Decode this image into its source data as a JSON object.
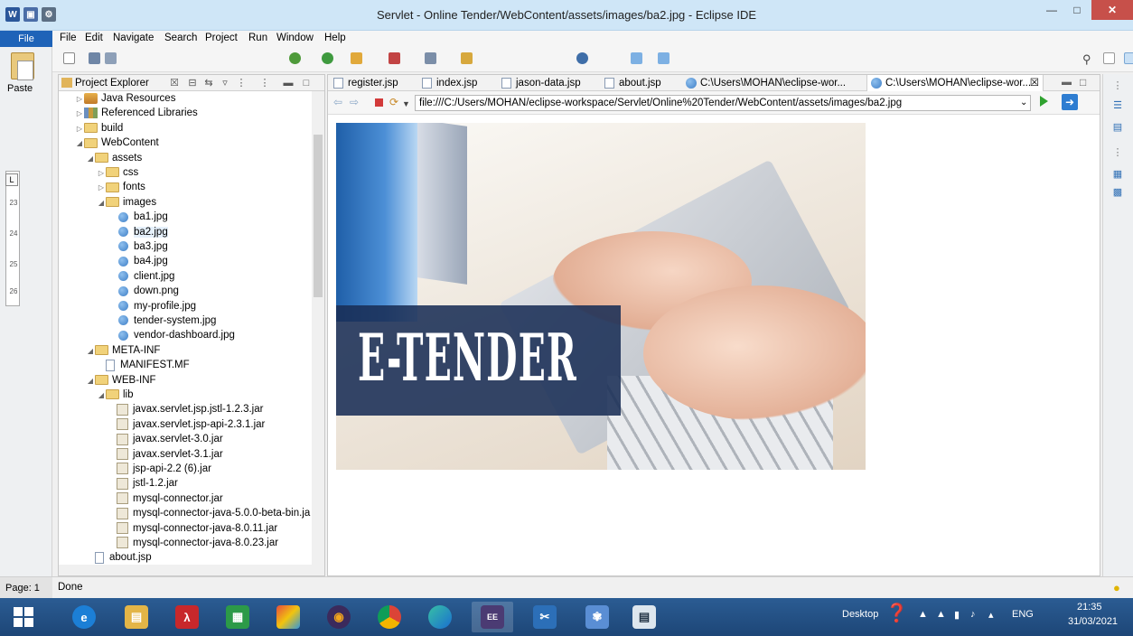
{
  "window": {
    "title": "Servlet - Online Tender/WebContent/assets/images/ba2.jpg - Eclipse IDE"
  },
  "menu": {
    "file": "File",
    "items": [
      "File",
      "Edit",
      "Navigate",
      "Search",
      "Project",
      "Run",
      "Window",
      "Help"
    ]
  },
  "ribbon": {
    "paste_label": "Paste"
  },
  "project_explorer": {
    "title": "Project Explorer",
    "close_glyph": "☒",
    "tree": [
      {
        "label": "Java Resources",
        "icon": "java-res",
        "twisty": "▷",
        "indent": 1
      },
      {
        "label": "Referenced Libraries",
        "icon": "reflib",
        "twisty": "▷",
        "indent": 1
      },
      {
        "label": "build",
        "icon": "folder",
        "twisty": "▷",
        "indent": 1
      },
      {
        "label": "WebContent",
        "icon": "folder",
        "twisty": "◢",
        "indent": 1
      },
      {
        "label": "assets",
        "icon": "folder",
        "twisty": "◢",
        "indent": 2
      },
      {
        "label": "css",
        "icon": "folder",
        "twisty": "▷",
        "indent": 3
      },
      {
        "label": "fonts",
        "icon": "folder",
        "twisty": "▷",
        "indent": 3
      },
      {
        "label": "images",
        "icon": "folder",
        "twisty": "◢",
        "indent": 3
      },
      {
        "label": "ba1.jpg",
        "icon": "imgdot",
        "twisty": "",
        "indent": 4
      },
      {
        "label": "ba2.jpg",
        "icon": "imgdot",
        "twisty": "",
        "indent": 4
      },
      {
        "label": "ba3.jpg",
        "icon": "imgdot",
        "twisty": "",
        "indent": 4
      },
      {
        "label": "ba4.jpg",
        "icon": "imgdot",
        "twisty": "",
        "indent": 4
      },
      {
        "label": "client.jpg",
        "icon": "imgdot",
        "twisty": "",
        "indent": 4
      },
      {
        "label": "down.png",
        "icon": "imgdot",
        "twisty": "",
        "indent": 4
      },
      {
        "label": "my-profile.jpg",
        "icon": "imgdot",
        "twisty": "",
        "indent": 4
      },
      {
        "label": "tender-system.jpg",
        "icon": "imgdot",
        "twisty": "",
        "indent": 4
      },
      {
        "label": "vendor-dashboard.jpg",
        "icon": "imgdot",
        "twisty": "",
        "indent": 4
      },
      {
        "label": "META-INF",
        "icon": "folder",
        "twisty": "◢",
        "indent": 2
      },
      {
        "label": "MANIFEST.MF",
        "icon": "doc",
        "twisty": "",
        "indent": 3
      },
      {
        "label": "WEB-INF",
        "icon": "folder",
        "twisty": "◢",
        "indent": 2
      },
      {
        "label": "lib",
        "icon": "folder",
        "twisty": "◢",
        "indent": 3
      },
      {
        "label": "javax.servlet.jsp.jstl-1.2.3.jar",
        "icon": "jar",
        "twisty": "",
        "indent": 4
      },
      {
        "label": "javax.servlet.jsp-api-2.3.1.jar",
        "icon": "jar",
        "twisty": "",
        "indent": 4
      },
      {
        "label": "javax.servlet-3.0.jar",
        "icon": "jar",
        "twisty": "",
        "indent": 4
      },
      {
        "label": "javax.servlet-3.1.jar",
        "icon": "jar",
        "twisty": "",
        "indent": 4
      },
      {
        "label": "jsp-api-2.2 (6).jar",
        "icon": "jar",
        "twisty": "",
        "indent": 4
      },
      {
        "label": "jstl-1.2.jar",
        "icon": "jar",
        "twisty": "",
        "indent": 4
      },
      {
        "label": "mysql-connector.jar",
        "icon": "jar",
        "twisty": "",
        "indent": 4
      },
      {
        "label": "mysql-connector-java-5.0.0-beta-bin.ja",
        "icon": "jar",
        "twisty": "",
        "indent": 4
      },
      {
        "label": "mysql-connector-java-8.0.11.jar",
        "icon": "jar",
        "twisty": "",
        "indent": 4
      },
      {
        "label": "mysql-connector-java-8.0.23.jar",
        "icon": "jar",
        "twisty": "",
        "indent": 4
      },
      {
        "label": "about.jsp",
        "icon": "doc",
        "twisty": "",
        "indent": 2
      }
    ]
  },
  "editor": {
    "tabs": [
      {
        "label": "register.jsp",
        "icon": "jsp"
      },
      {
        "label": "index.jsp",
        "icon": "jsp"
      },
      {
        "label": "jason-data.jsp",
        "icon": "jsp"
      },
      {
        "label": "about.jsp",
        "icon": "jsp"
      },
      {
        "label": "C:\\Users\\MOHAN\\eclipse-wor...",
        "icon": "globe"
      },
      {
        "label": "C:\\Users\\MOHAN\\eclipse-wor...",
        "icon": "globe",
        "active": true,
        "close": "☒"
      }
    ],
    "url": "file:///C:/Users/MOHAN/eclipse-workspace/Servlet/Online%20Tender/WebContent/assets/images/ba2.jpg",
    "image_text": "E-TENDER"
  },
  "status": {
    "page": "Page: 1",
    "text": "Done"
  },
  "taskbar": {
    "desktop": "Desktop",
    "lang": "ENG",
    "time": "21:35",
    "date": "31/03/2021"
  },
  "colors": {
    "titlebar": "#cfe6f7",
    "file_tab": "#1e63b8",
    "taskbar": "#1d4677",
    "close": "#c7504a"
  }
}
